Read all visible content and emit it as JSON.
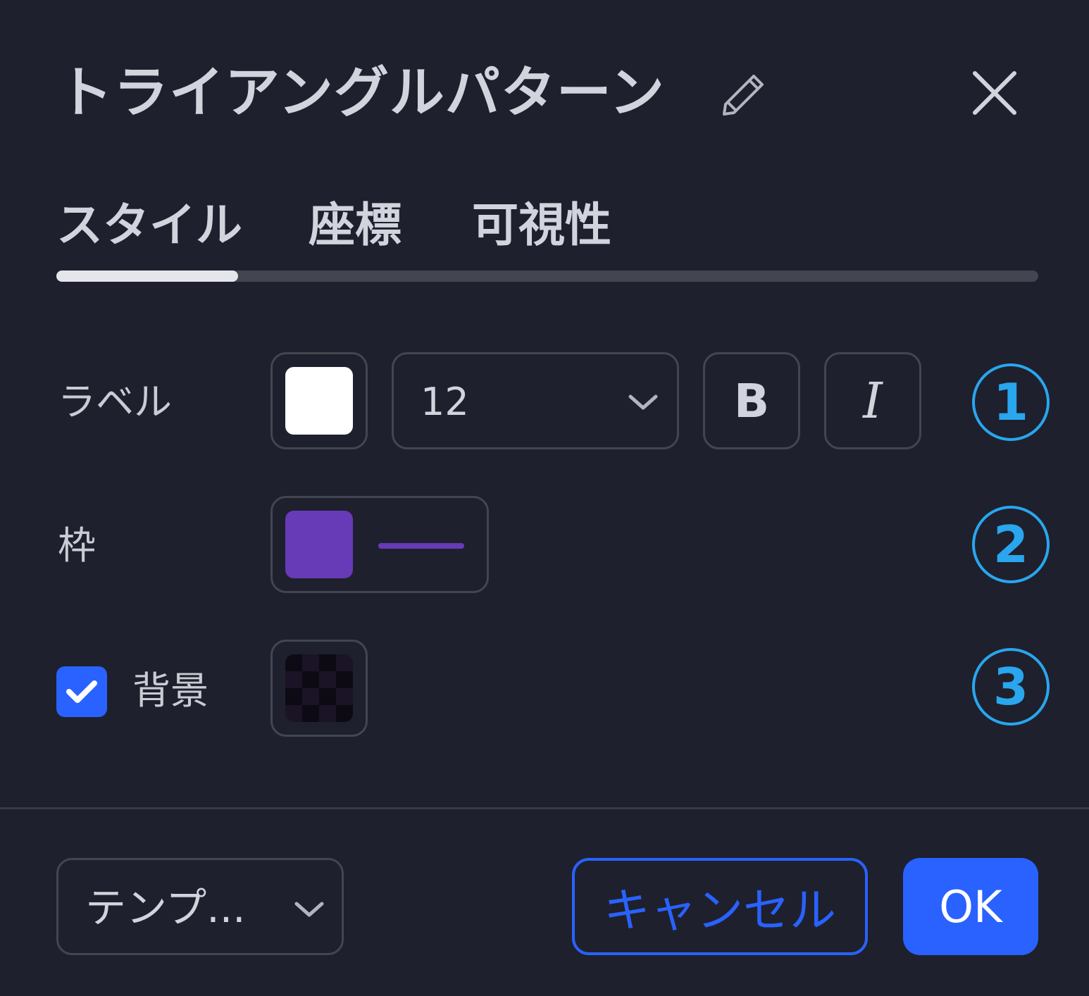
{
  "dialog": {
    "title": "トライアングルパターン",
    "icons": {
      "edit": "pencil-icon",
      "close": "close-icon"
    }
  },
  "tabs": [
    {
      "label": "スタイル",
      "active": true
    },
    {
      "label": "座標",
      "active": false
    },
    {
      "label": "可視性",
      "active": false
    }
  ],
  "rows": {
    "label": {
      "name": "ラベル",
      "color": "#ffffff",
      "font_size": "12",
      "bold_label": "B",
      "italic_label": "I",
      "badge": "1"
    },
    "border": {
      "name": "枠",
      "color": "#673ab7",
      "badge": "2"
    },
    "background": {
      "name": "背景",
      "checked": true,
      "color": "#1a1426",
      "badge": "3"
    }
  },
  "footer": {
    "template_label": "テンプ...",
    "cancel_label": "キャンセル",
    "ok_label": "OK"
  },
  "colors": {
    "accent": "#2962ff",
    "badge": "#29a6ee",
    "background": "#1e202d"
  }
}
